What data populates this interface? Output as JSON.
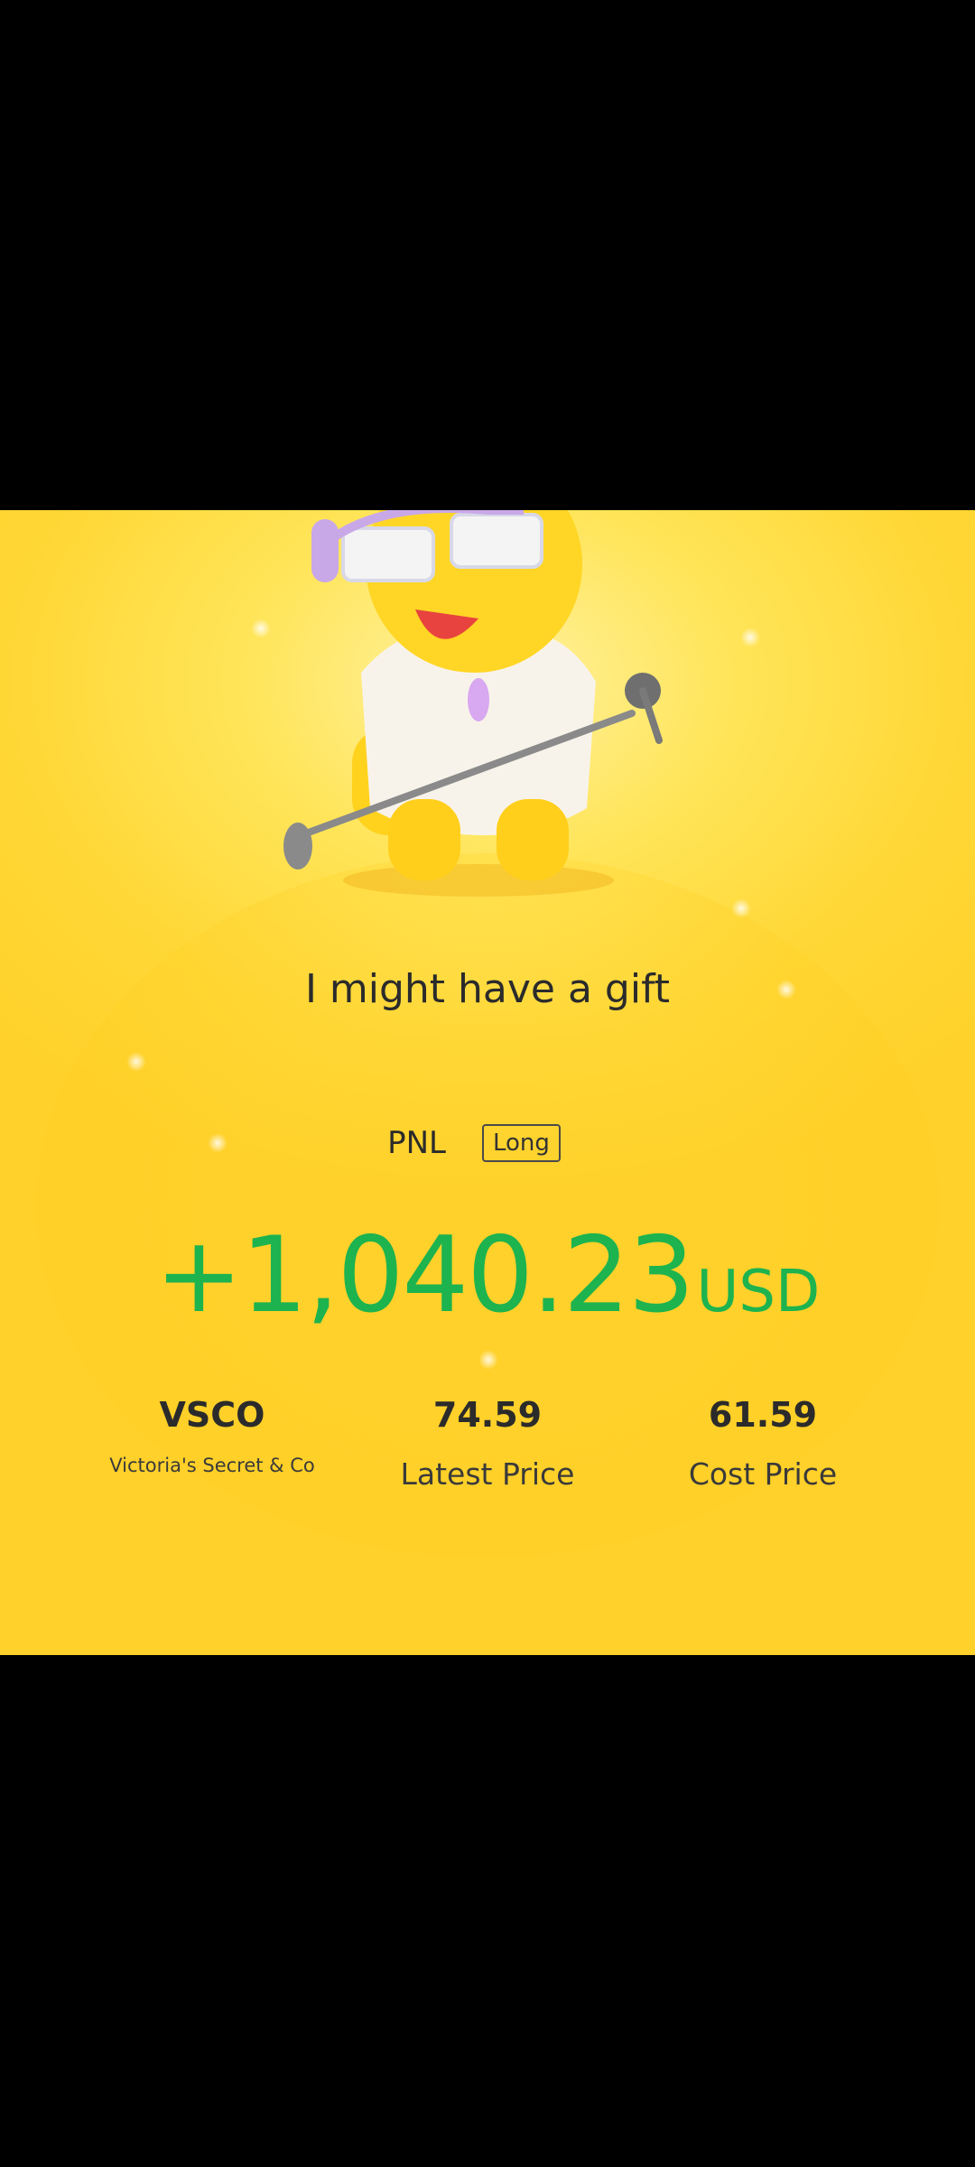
{
  "card": {
    "headline": "I might have a gift",
    "pnl_label": "PNL",
    "position_type": "Long",
    "pnl_value": "+1,040.23",
    "pnl_unit": "USD",
    "colors": {
      "background": "#ffd735",
      "pnl_positive": "#1db34f",
      "text": "#2b2b2b"
    }
  },
  "stats": {
    "ticker": "VSCO",
    "company": "Victoria's Secret & Co",
    "latest_price": "74.59",
    "latest_price_label": "Latest Price",
    "cost_price": "61.59",
    "cost_price_label": "Cost Price"
  },
  "icons": {
    "mascot": "tiger-mascot-with-microphone"
  }
}
